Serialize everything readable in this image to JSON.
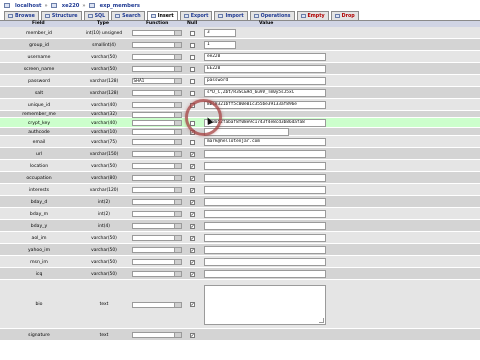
{
  "breadcrumb": {
    "server": "localhost",
    "database": "xe220",
    "table": "exp_members",
    "separator": "»"
  },
  "tabs": [
    {
      "label": "Browse"
    },
    {
      "label": "Structure"
    },
    {
      "label": "SQL"
    },
    {
      "label": "Search"
    },
    {
      "label": "Insert"
    },
    {
      "label": "Export"
    },
    {
      "label": "Import"
    },
    {
      "label": "Operations"
    },
    {
      "label": "Empty"
    },
    {
      "label": "Drop"
    }
  ],
  "columns": {
    "field": "Field",
    "type": "Type",
    "function": "Function",
    "null": "Null",
    "value": "Value"
  },
  "rows": [
    {
      "field": "member_id",
      "type": "int(10) unsigned",
      "func": "",
      "null": false,
      "value": "3"
    },
    {
      "field": "group_id",
      "type": "smallint(4)",
      "func": "",
      "null": false,
      "value": "1"
    },
    {
      "field": "username",
      "type": "varchar(50)",
      "func": "",
      "null": false,
      "value": "ee220"
    },
    {
      "field": "screen_name",
      "type": "varchar(50)",
      "func": "",
      "null": false,
      "value": "EE220"
    },
    {
      "field": "password",
      "type": "varchar(128)",
      "func": "SHA1",
      "null": false,
      "value": "password"
    },
    {
      "field": "salt",
      "type": "varchar(128)",
      "func": "",
      "null": false,
      "value": "s*D_C,Zbt/R3SC&9d_6u9V_Tm0y5sJ5xC"
    },
    {
      "field": "unique_id",
      "type": "varchar(40)",
      "func": "",
      "null": false,
      "value": "8bc8321bff5c00e01c355be39133af896e"
    },
    {
      "field": "remember_me",
      "type": "varchar(32)",
      "func": "",
      "null": false,
      "value": ""
    },
    {
      "field": "crypt_key",
      "type": "varchar(40)",
      "func": "",
      "null": false,
      "value": "ff8052fabaf8f08e9c1743f4e8cd3b86dafa8"
    },
    {
      "field": "authcode",
      "type": "varchar(10)",
      "func": "",
      "null": true,
      "value": ""
    },
    {
      "field": "email",
      "type": "varchar(75)",
      "func": "",
      "null": false,
      "value": "mark@hellotenjar.com"
    },
    {
      "field": "url",
      "type": "varchar(150)",
      "func": "",
      "null": true,
      "value": ""
    },
    {
      "field": "location",
      "type": "varchar(50)",
      "func": "",
      "null": true,
      "value": ""
    },
    {
      "field": "occupation",
      "type": "varchar(80)",
      "func": "",
      "null": true,
      "value": ""
    },
    {
      "field": "interests",
      "type": "varchar(120)",
      "func": "",
      "null": true,
      "value": ""
    },
    {
      "field": "bday_d",
      "type": "int(2)",
      "func": "",
      "null": true,
      "value": ""
    },
    {
      "field": "bday_m",
      "type": "int(2)",
      "func": "",
      "null": true,
      "value": ""
    },
    {
      "field": "bday_y",
      "type": "int(4)",
      "func": "",
      "null": true,
      "value": ""
    },
    {
      "field": "aol_im",
      "type": "varchar(50)",
      "func": "",
      "null": true,
      "value": ""
    },
    {
      "field": "yahoo_im",
      "type": "varchar(50)",
      "func": "",
      "null": true,
      "value": ""
    },
    {
      "field": "msn_im",
      "type": "varchar(50)",
      "func": "",
      "null": true,
      "value": ""
    },
    {
      "field": "icq",
      "type": "varchar(50)",
      "func": "",
      "null": true,
      "value": ""
    },
    {
      "field": "bio",
      "type": "text",
      "func": "",
      "null": true,
      "value": ""
    },
    {
      "field": "signature",
      "type": "text",
      "func": "",
      "null": true,
      "value": ""
    }
  ],
  "colors": {
    "header": "#d0d4e4",
    "row_odd": "#e5e5e5",
    "row_even": "#d4d4d4",
    "row_highlight": "#ccffcc",
    "link": "#1f3a93"
  }
}
